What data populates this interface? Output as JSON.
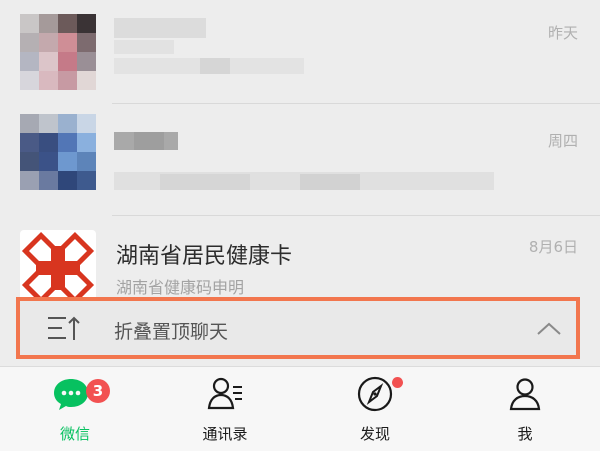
{
  "chats": [
    {
      "time": "昨天"
    },
    {
      "time": "周四"
    },
    {
      "title": "湖南省居民健康卡",
      "subtitle": "湖南省健康码申明",
      "time": "8月6日"
    }
  ],
  "fold_bar": {
    "label": "折叠置顶聊天"
  },
  "tabs": [
    {
      "label": "微信",
      "badge": "3"
    },
    {
      "label": "通讯录"
    },
    {
      "label": "发现"
    },
    {
      "label": "我"
    }
  ],
  "colors": {
    "accent": "#07c160",
    "badge": "#f25151",
    "highlight_border": "#f2764e"
  }
}
